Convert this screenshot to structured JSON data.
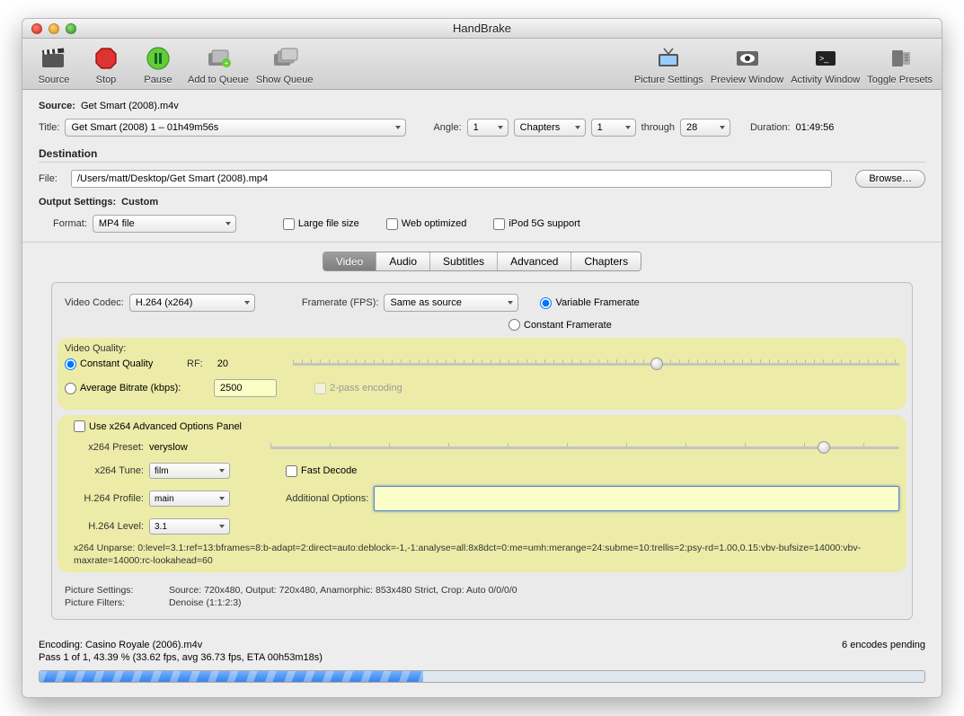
{
  "window": {
    "title": "HandBrake"
  },
  "toolbar": {
    "source": "Source",
    "stop": "Stop",
    "pause": "Pause",
    "addqueue": "Add to Queue",
    "showqueue": "Show Queue",
    "picsettings": "Picture Settings",
    "preview": "Preview Window",
    "activity": "Activity Window",
    "toggle": "Toggle Presets"
  },
  "source": {
    "label": "Source:",
    "filename": "Get Smart (2008).m4v",
    "title_label": "Title:",
    "title_value": "Get Smart (2008) 1 – 01h49m56s",
    "angle_label": "Angle:",
    "angle_value": "1",
    "chapters_label": "Chapters",
    "chap_from": "1",
    "through": "through",
    "chap_to": "28",
    "duration_label": "Duration:",
    "duration_value": "01:49:56"
  },
  "dest": {
    "section": "Destination",
    "file_label": "File:",
    "file_value": "/Users/matt/Desktop/Get Smart (2008).mp4",
    "browse": "Browse…"
  },
  "output": {
    "section": "Output Settings:",
    "custom": "Custom",
    "format_label": "Format:",
    "format_value": "MP4 file",
    "large": "Large file size",
    "web": "Web optimized",
    "ipod": "iPod 5G support"
  },
  "tabs": {
    "video": "Video",
    "audio": "Audio",
    "subtitles": "Subtitles",
    "advanced": "Advanced",
    "chapters": "Chapters"
  },
  "video": {
    "codec_label": "Video Codec:",
    "codec_value": "H.264 (x264)",
    "fps_label": "Framerate (FPS):",
    "fps_value": "Same as source",
    "vfr": "Variable Framerate",
    "cfr": "Constant Framerate",
    "quality_label": "Video Quality:",
    "cq": "Constant Quality",
    "rf_label": "RF:",
    "rf_value": "20",
    "abr": "Average Bitrate (kbps):",
    "abr_value": "2500",
    "twopass": "2-pass encoding",
    "use_adv": "Use x264 Advanced Options Panel",
    "preset_label": "x264 Preset:",
    "preset_value": "veryslow",
    "tune_label": "x264 Tune:",
    "tune_value": "film",
    "fast_decode": "Fast Decode",
    "profile_label": "H.264 Profile:",
    "profile_value": "main",
    "level_label": "H.264 Level:",
    "level_value": "3.1",
    "addl_label": "Additional Options:",
    "unparse": "x264 Unparse: 0:level=3.1:ref=13:bframes=8:b-adapt=2:direct=auto:deblock=-1,-1:analyse=all:8x8dct=0:me=umh:merange=24:subme=10:trellis=2:psy-rd=1.00,0.15:vbv-bufsize=14000:vbv-maxrate=14000:rc-lookahead=60",
    "pic_settings_label": "Picture Settings:",
    "pic_settings_value": "Source: 720x480, Output: 720x480, Anamorphic: 853x480 Strict, Crop: Auto 0/0/0/0",
    "pic_filters_label": "Picture Filters:",
    "pic_filters_value": "Denoise (1:1:2:3)"
  },
  "status": {
    "encoding": "Encoding: Casino Royale (2006).m4v",
    "pass": "Pass 1 of 1, 43.39 % (33.62 fps, avg 36.73 fps, ETA 00h53m18s)",
    "pending": "6 encodes pending"
  }
}
